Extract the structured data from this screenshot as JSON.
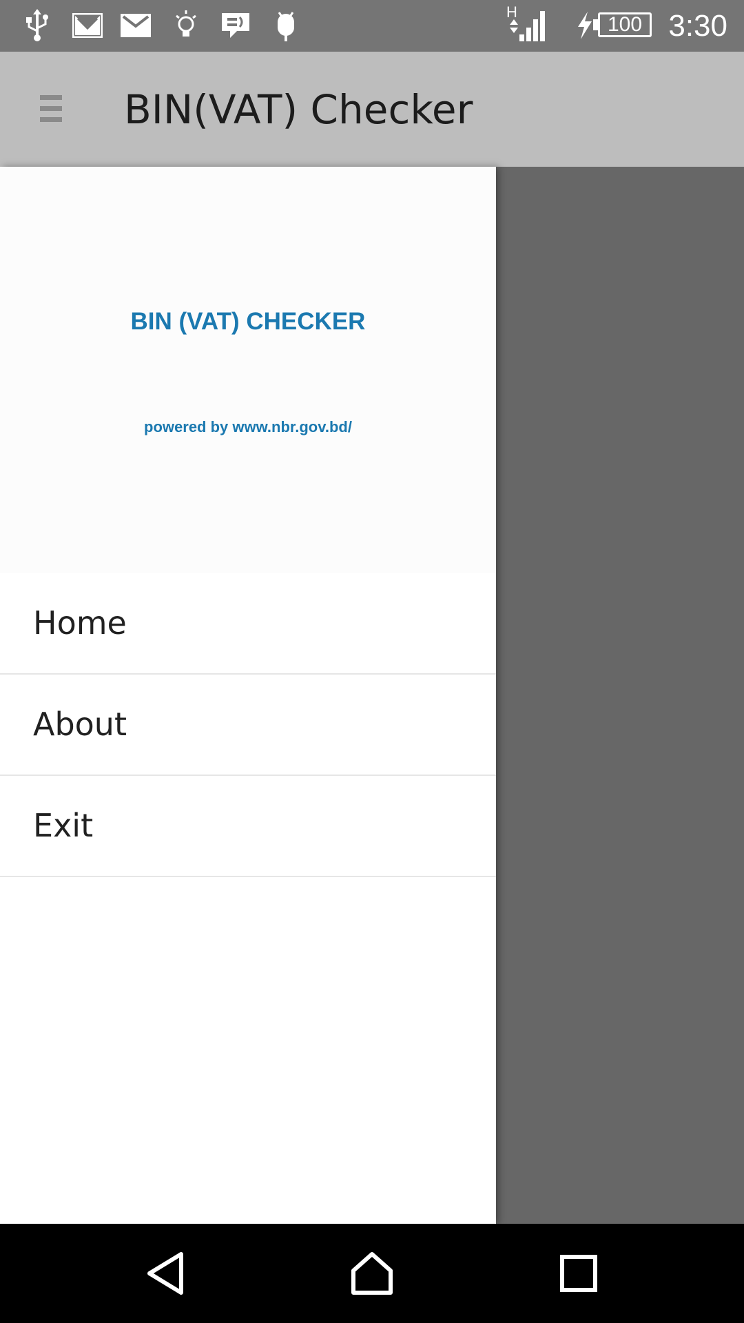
{
  "status_bar": {
    "time": "3:30",
    "battery_level": "100",
    "network_type": "H",
    "icons": [
      "usb-icon",
      "gmail-icon",
      "mail-icon",
      "lightbulb-icon",
      "message-icon",
      "android-icon",
      "signal-icon",
      "charging-icon",
      "battery-icon"
    ]
  },
  "app_bar": {
    "title": "BIN(VAT) Checker",
    "menu_icon": "hamburger-icon"
  },
  "drawer": {
    "header_title": "BIN (VAT) CHECKER",
    "header_subtitle": "powered by www.nbr.gov.bd/",
    "items": [
      {
        "label": "Home"
      },
      {
        "label": "About"
      },
      {
        "label": "Exit"
      }
    ]
  },
  "nav_bar": {
    "icons": [
      "back-icon",
      "home-icon",
      "recents-icon"
    ]
  },
  "colors": {
    "status_bar": "#757575",
    "app_bar": "#bdbdbd",
    "accent_text": "#1b79b0",
    "scrim": "#676767",
    "nav_bar": "#000000"
  }
}
